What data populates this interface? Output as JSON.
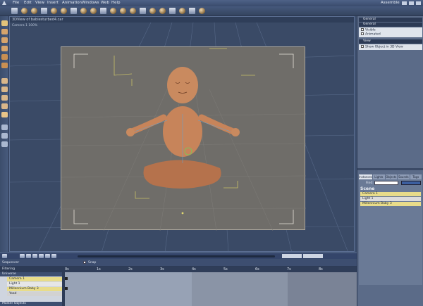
{
  "menubar": {
    "items": [
      "File",
      "Edit",
      "View",
      "Insert",
      "Animation",
      "Windows",
      "Web",
      "Help"
    ],
    "room": "Assemble"
  },
  "viewport": {
    "header": "3DView of babiesturbed4.car",
    "camera_label": "Camera 1 100%"
  },
  "right_panel": {
    "title": "General",
    "general_header": "General",
    "general_options": [
      "Visible",
      "Animated"
    ],
    "view_header": "View",
    "view_options": [
      "Show Object in 3D View"
    ],
    "tabs": [
      "Instances",
      "Lights",
      "Objects",
      "Sounds",
      "Tags"
    ],
    "find_label": "Find:",
    "scene_title": "Scene",
    "scene_items": [
      "Camera 1",
      "Light 1",
      "Millennium Baby 3"
    ]
  },
  "timeline": {
    "sequencer_label": "Sequencer",
    "snap_label": "Snap",
    "filtering_label": "Filtering",
    "ruler_ticks": [
      "0s",
      "1s",
      "2s",
      "3s",
      "4s",
      "5s",
      "6s",
      "7s",
      "8s"
    ],
    "tracks": [
      "Universe",
      "Camera 1",
      "Light 1",
      "Millennium Baby 3",
      "Yoad",
      "Master Objects"
    ]
  },
  "colors": {
    "accent": "#3d4f6e",
    "panel": "#5b6b88",
    "selection": "#e8dc8a",
    "viewport_grid": "#6f6d69"
  }
}
